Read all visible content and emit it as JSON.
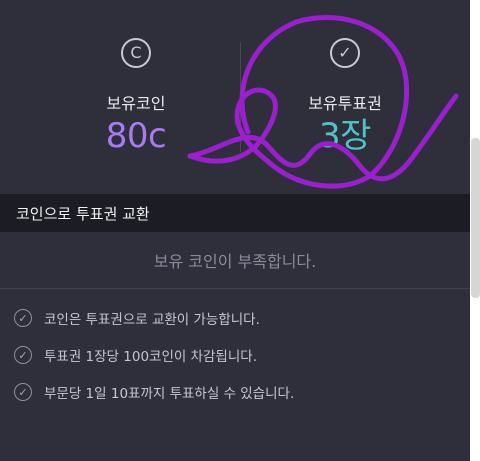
{
  "wallet": {
    "coin": {
      "icon": "coin-c-icon",
      "icon_glyph": "C",
      "label": "보유코인",
      "value": "80c"
    },
    "ticket": {
      "icon": "check-circle-icon",
      "icon_glyph": "✓",
      "label": "보유투표권",
      "value": "3장"
    }
  },
  "exchange": {
    "header": "코인으로 투표권 교환",
    "status_message": "보유 코인이 부족합니다."
  },
  "notices": [
    {
      "icon": "check-circle-icon",
      "glyph": "✓",
      "text": "코인은 투표권으로 교환이 가능합니다."
    },
    {
      "icon": "check-circle-icon",
      "glyph": "✓",
      "text": "투표권 1장당 100코인이 차감됩니다."
    },
    {
      "icon": "check-circle-icon",
      "glyph": "✓",
      "text": "부문당 1일 10표까지 투표하실 수 있습니다."
    }
  ],
  "colors": {
    "background": "#2f2f3c",
    "header_bar": "#1c1c24",
    "coin_value": "#a77cf3",
    "ticket_value": "#4fc3c6",
    "annotation_stroke": "#9b1ecf"
  }
}
